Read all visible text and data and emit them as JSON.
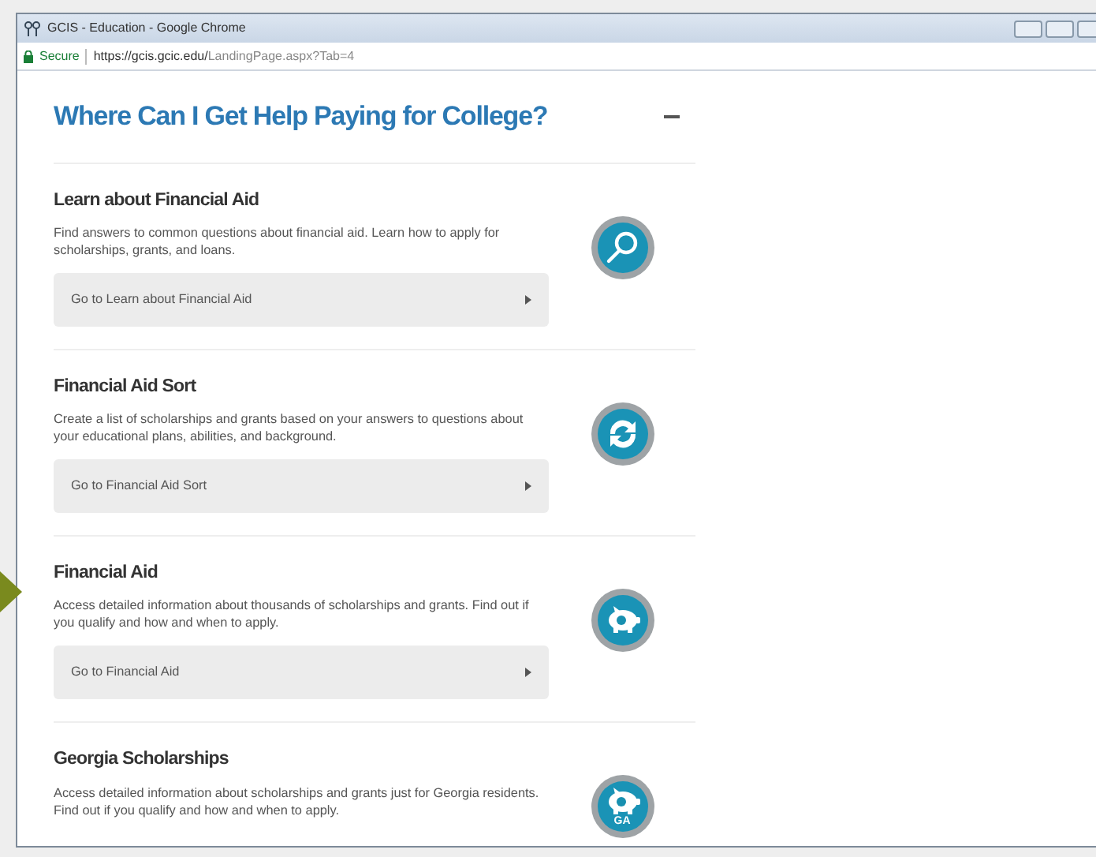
{
  "window": {
    "title": "GCIS - Education - Google Chrome"
  },
  "address_bar": {
    "secure_label": "Secure",
    "url_host": "https://gcis.gcic.edu/",
    "url_path": "LandingPage.aspx?Tab=4"
  },
  "section": {
    "title": "Where Can I Get Help Paying for College?",
    "expanded": true
  },
  "items": [
    {
      "title": "Learn about Financial Aid",
      "description": "Find answers to common questions about financial aid. Learn how to apply for scholarships, grants, and loans.",
      "link": "Go to Learn about Financial Aid",
      "kind": "search"
    },
    {
      "title": "Financial Aid Sort",
      "description": "Create a list of scholarships and grants based on your answers to questions about your educational plans, abilities, and background.",
      "link": "Go to Financial Aid Sort",
      "kind": "sort"
    },
    {
      "title": "Financial Aid",
      "description": "Access detailed information about thousands of scholarships and grants. Find out if you qualify and how and when to apply.",
      "link": "Go to Financial Aid",
      "kind": "piggy"
    },
    {
      "title": "Georgia Scholarships",
      "description": "Access detailed information about scholarships and grants just for Georgia residents. Find out if you qualify and how and when to apply.",
      "kind": "piggy-state",
      "icon_label": "GA"
    }
  ]
}
